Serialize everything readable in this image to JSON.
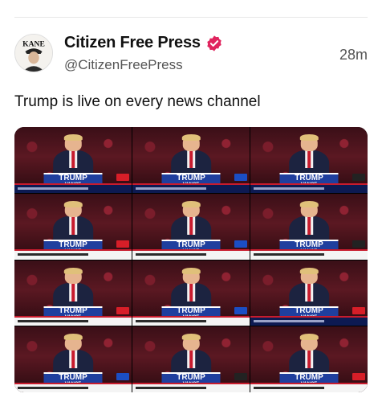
{
  "post": {
    "display_name": "Citizen Free Press",
    "handle": "@CitizenFreePress",
    "timestamp": "28m",
    "text": "Trump is live on every news channel",
    "avatar_text": "KANE",
    "verified_color": "#e0245e"
  },
  "media": {
    "tiles": [
      {
        "podium_top": "TRUMP",
        "podium_bottom": "VANCE"
      },
      {
        "podium_top": "TRUMP",
        "podium_bottom": "VANCE"
      },
      {
        "podium_top": "TRUMP",
        "podium_bottom": "VANCE"
      },
      {
        "podium_top": "TRUMP",
        "podium_bottom": "VANCE"
      },
      {
        "podium_top": "TRUMP",
        "podium_bottom": "VANCE"
      },
      {
        "podium_top": "TRUMP",
        "podium_bottom": "VANCE"
      },
      {
        "podium_top": "TRUMP",
        "podium_bottom": "VANCE"
      },
      {
        "podium_top": "TRUMP",
        "podium_bottom": "VANCE"
      },
      {
        "podium_top": "TRUMP",
        "podium_bottom": "VANCE"
      },
      {
        "podium_top": "TRUMP",
        "podium_bottom": "VANCE"
      },
      {
        "podium_top": "TRUMP",
        "podium_bottom": "VANCE"
      },
      {
        "podium_top": "TRUMP",
        "podium_bottom": "VANCE"
      }
    ]
  }
}
